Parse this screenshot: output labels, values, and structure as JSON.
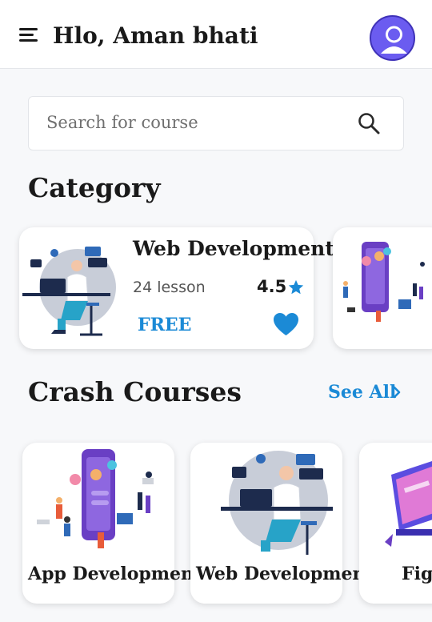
{
  "header": {
    "greeting": "Hlo, Aman bhati"
  },
  "search": {
    "placeholder": "Search for course"
  },
  "category": {
    "title": "Category",
    "featured": {
      "name": "Web Development",
      "lessons": "24 lesson",
      "rating": "4.5",
      "price": "FREE"
    }
  },
  "crash_courses": {
    "title": "Crash Courses",
    "see_all": "See All",
    "items": [
      {
        "label": "App Development"
      },
      {
        "label": "Web Development"
      },
      {
        "label": "Fign"
      }
    ]
  },
  "colors": {
    "accent": "#1b8ad6",
    "avatar": "#6b5cf0",
    "illustration_purple": "#6a3fc4"
  },
  "icons": [
    "hamburger-icon",
    "avatar-icon",
    "search-icon",
    "star-icon",
    "heart-icon",
    "chevron-right-icon"
  ]
}
